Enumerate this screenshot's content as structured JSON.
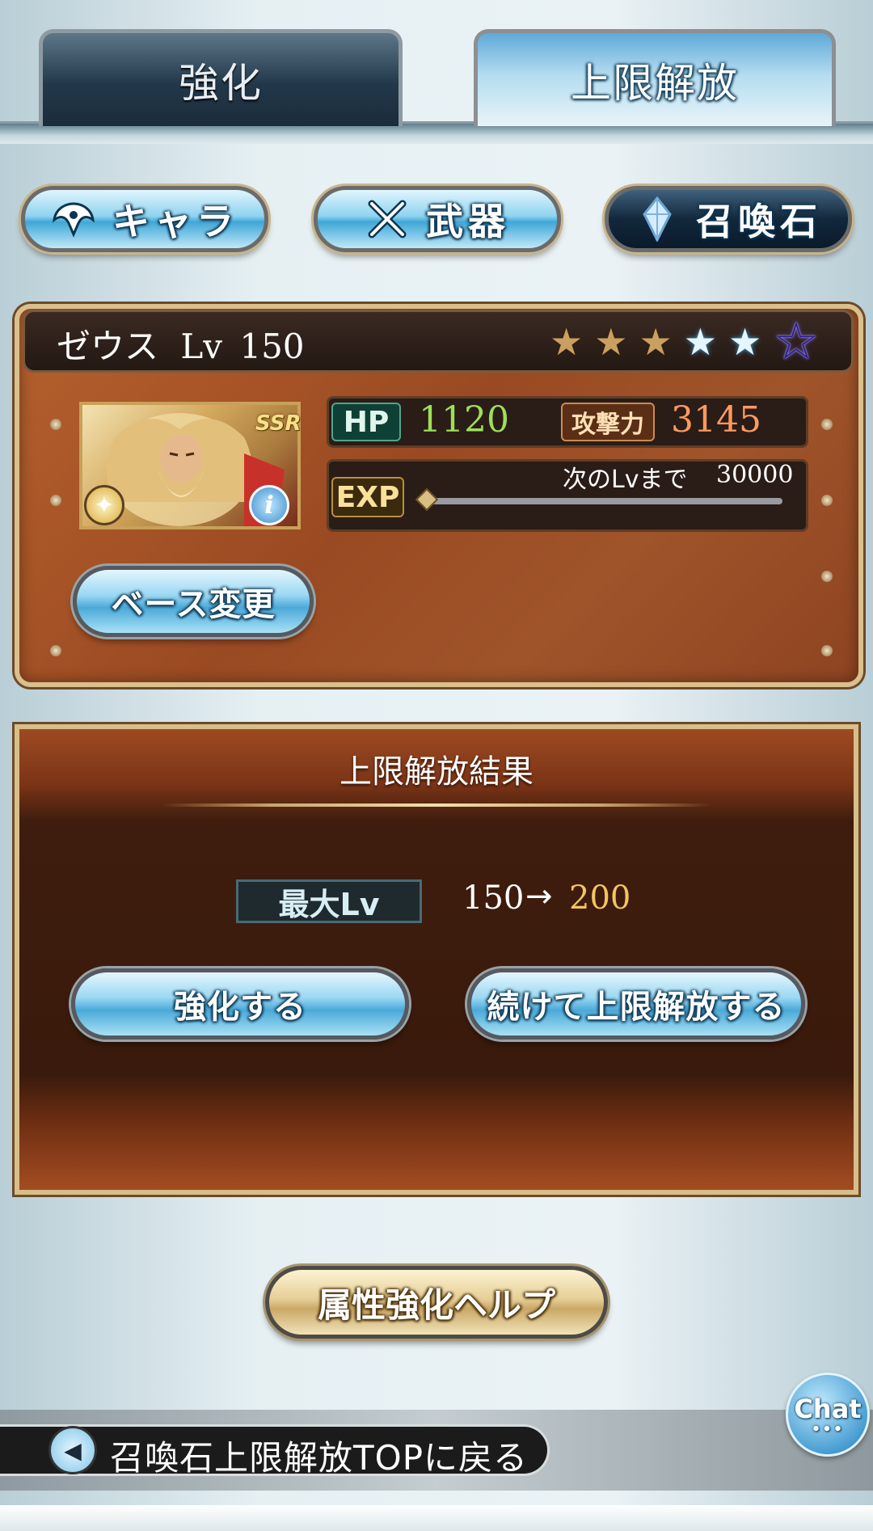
{
  "tabs": [
    {
      "label": "強化"
    },
    {
      "label": "上限解放"
    }
  ],
  "categories": [
    {
      "label": "キャラ",
      "icon": "character-icon"
    },
    {
      "label": "武器",
      "icon": "weapon-icon"
    },
    {
      "label": "召喚石",
      "icon": "summon-stone-icon"
    }
  ],
  "summon": {
    "name": "ゼウス",
    "level_label": "Lv",
    "level": "150",
    "rarity": "SSR",
    "stars": {
      "gold": 3,
      "blue": 2,
      "purple": 1
    },
    "hp_label": "HP",
    "hp": "1120",
    "atk_label": "攻撃力",
    "atk": "3145",
    "exp_label": "EXP",
    "next_level_label": "次のLvまで",
    "next_level_exp": "30000",
    "exp_progress": 0,
    "base_change_label": "ベース変更"
  },
  "result": {
    "title": "上限解放結果",
    "max_level_label": "最大Lv",
    "from": "150",
    "arrow": "→",
    "to": "200",
    "enhance_label": "強化する",
    "continue_label": "続けて上限解放する"
  },
  "help_label": "属性強化ヘルプ",
  "chat_label": "Chat",
  "back_label": "召喚石上限解放TOPに戻る",
  "colors": {
    "hp_value": "#9de055",
    "atk_value": "#ff9a5e",
    "level_after": "#f6c460",
    "panel_bronze": "#b6602d"
  }
}
